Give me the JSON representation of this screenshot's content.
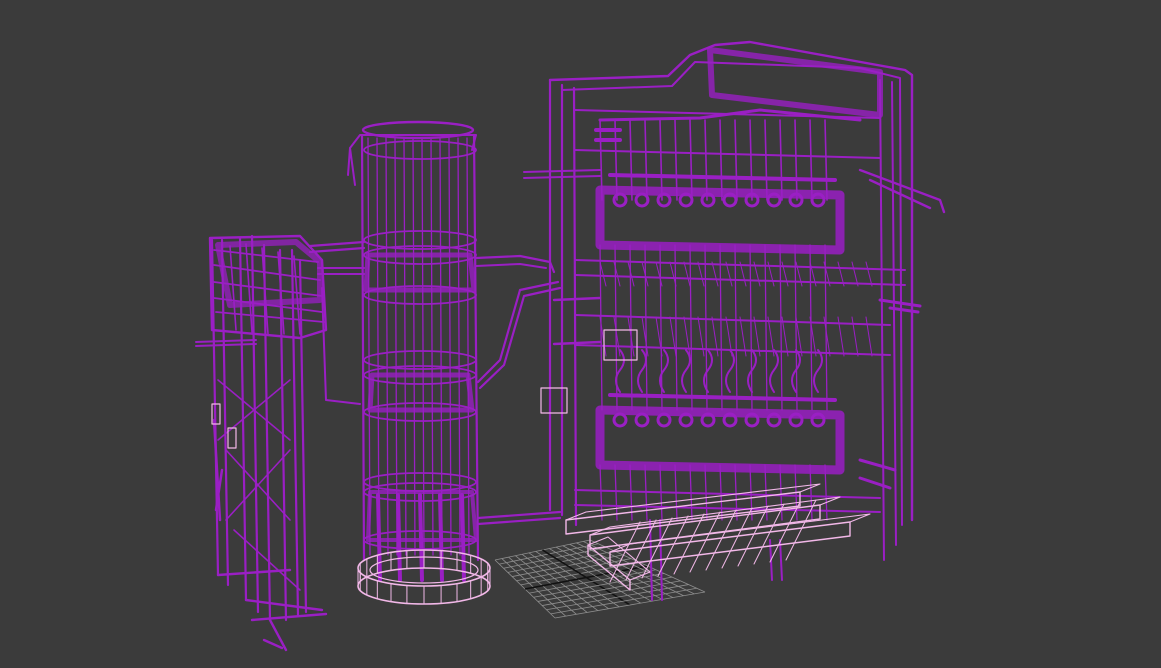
{
  "viewport": {
    "label": "",
    "colors": {
      "background": "#3b3b3b",
      "wireframe": "#9a1fc4",
      "wireframe_dense": "#8a1ab3",
      "selected": "#f2b8e8",
      "grid": "#8e8e8e",
      "grid_axis": "#111111"
    }
  },
  "scene": {
    "objects": [
      "left-frame-rack",
      "cylindrical-tower",
      "right-process-skid",
      "tower-base-ring",
      "floor-pallets",
      "home-grid"
    ]
  }
}
